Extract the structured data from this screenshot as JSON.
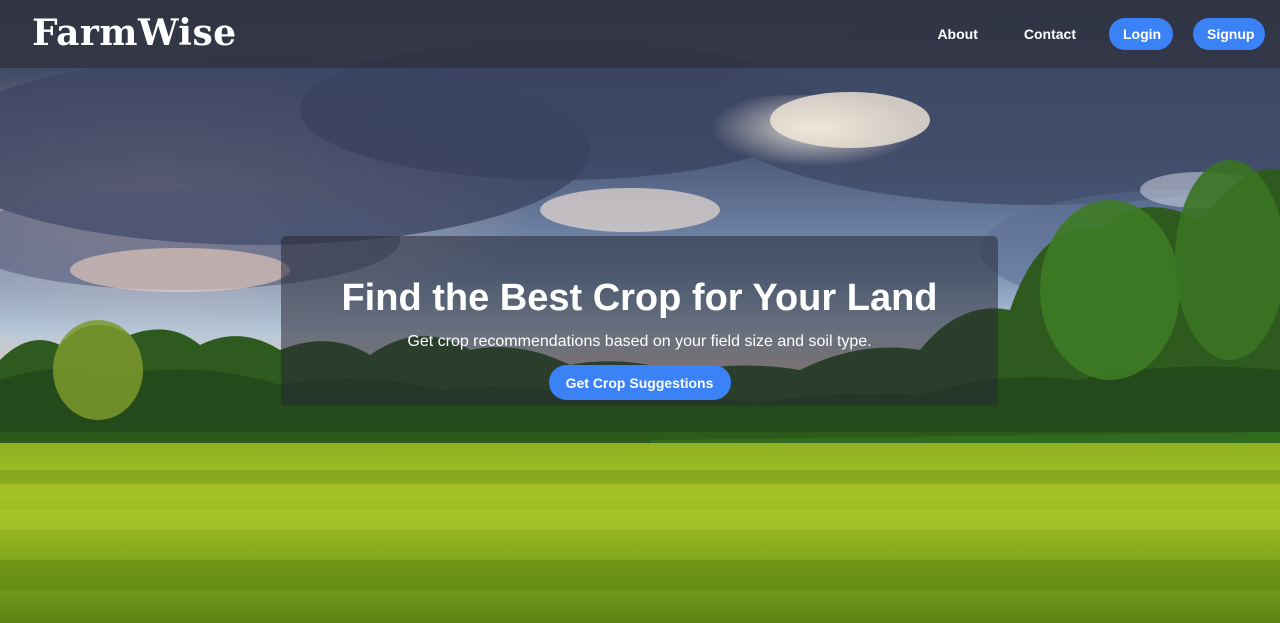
{
  "navbar": {
    "logo": "FarmWise",
    "links": {
      "about": "About",
      "contact": "Contact"
    },
    "buttons": {
      "login": "Login",
      "signup": "Signup"
    }
  },
  "hero": {
    "title": "Find the Best Crop for Your Land",
    "subtitle": "Get crop recommendations based on your field size and soil type.",
    "cta": "Get Crop Suggestions"
  },
  "colors": {
    "accent": "#3b82f6",
    "navbar_overlay": "rgba(40,40,48,0.55)",
    "hero_overlay": "rgba(38,40,52,0.55)"
  }
}
